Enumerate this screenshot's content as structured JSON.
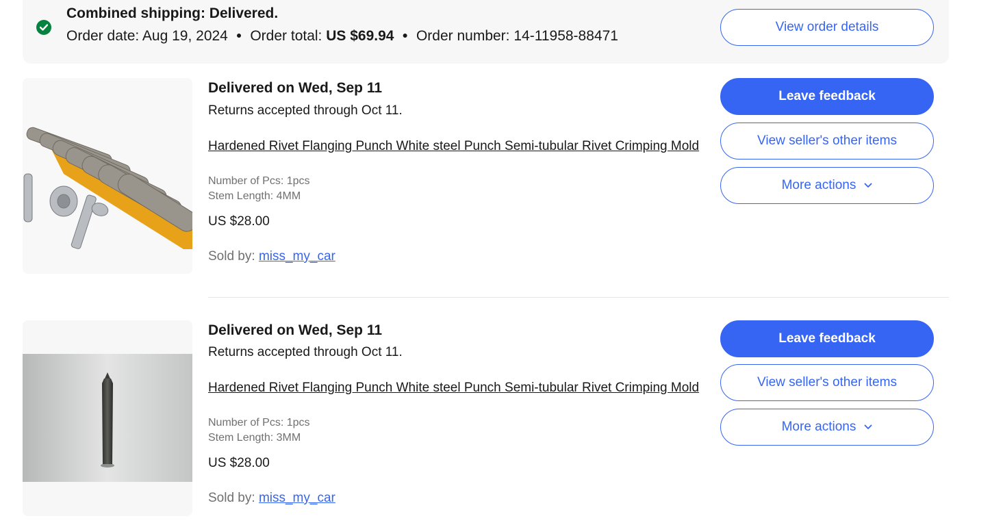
{
  "order": {
    "status": "Combined shipping: Delivered.",
    "date_label": "Order date:",
    "date_value": "Aug 19, 2024",
    "total_label": "Order total:",
    "total_value": "US $69.94",
    "number_label": "Order number:",
    "number_value": "14-11958-88471",
    "view_details_label": "View order details",
    "status_color": "#05823f"
  },
  "items": [
    {
      "status": "Delivered on Wed, Sep 11",
      "returns": "Returns accepted through Oct 11.",
      "title": "Hardened Rivet Flanging Punch White steel Punch Semi-tubular Rivet Crimping Mold",
      "attr1": "Number of Pcs: 1pcs",
      "attr2": "Stem Length: 4MM",
      "price": "US $28.00",
      "sold_by_label": "Sold by:",
      "seller": "miss_my_car",
      "leave_feedback_label": "Leave feedback",
      "view_seller_label": "View seller's other items",
      "more_actions_label": "More actions"
    },
    {
      "status": "Delivered on Wed, Sep 11",
      "returns": "Returns accepted through Oct 11.",
      "title": "Hardened Rivet Flanging Punch White steel Punch Semi-tubular Rivet Crimping Mold",
      "attr1": "Number of Pcs: 1pcs",
      "attr2": "Stem Length: 3MM",
      "price": "US $28.00",
      "sold_by_label": "Sold by:",
      "seller": "miss_my_car",
      "leave_feedback_label": "Leave feedback",
      "view_seller_label": "View seller's other items",
      "more_actions_label": "More actions"
    }
  ],
  "colors": {
    "accent": "#3665f3",
    "header_bg": "#f7f7f7",
    "muted_text": "#707070"
  }
}
